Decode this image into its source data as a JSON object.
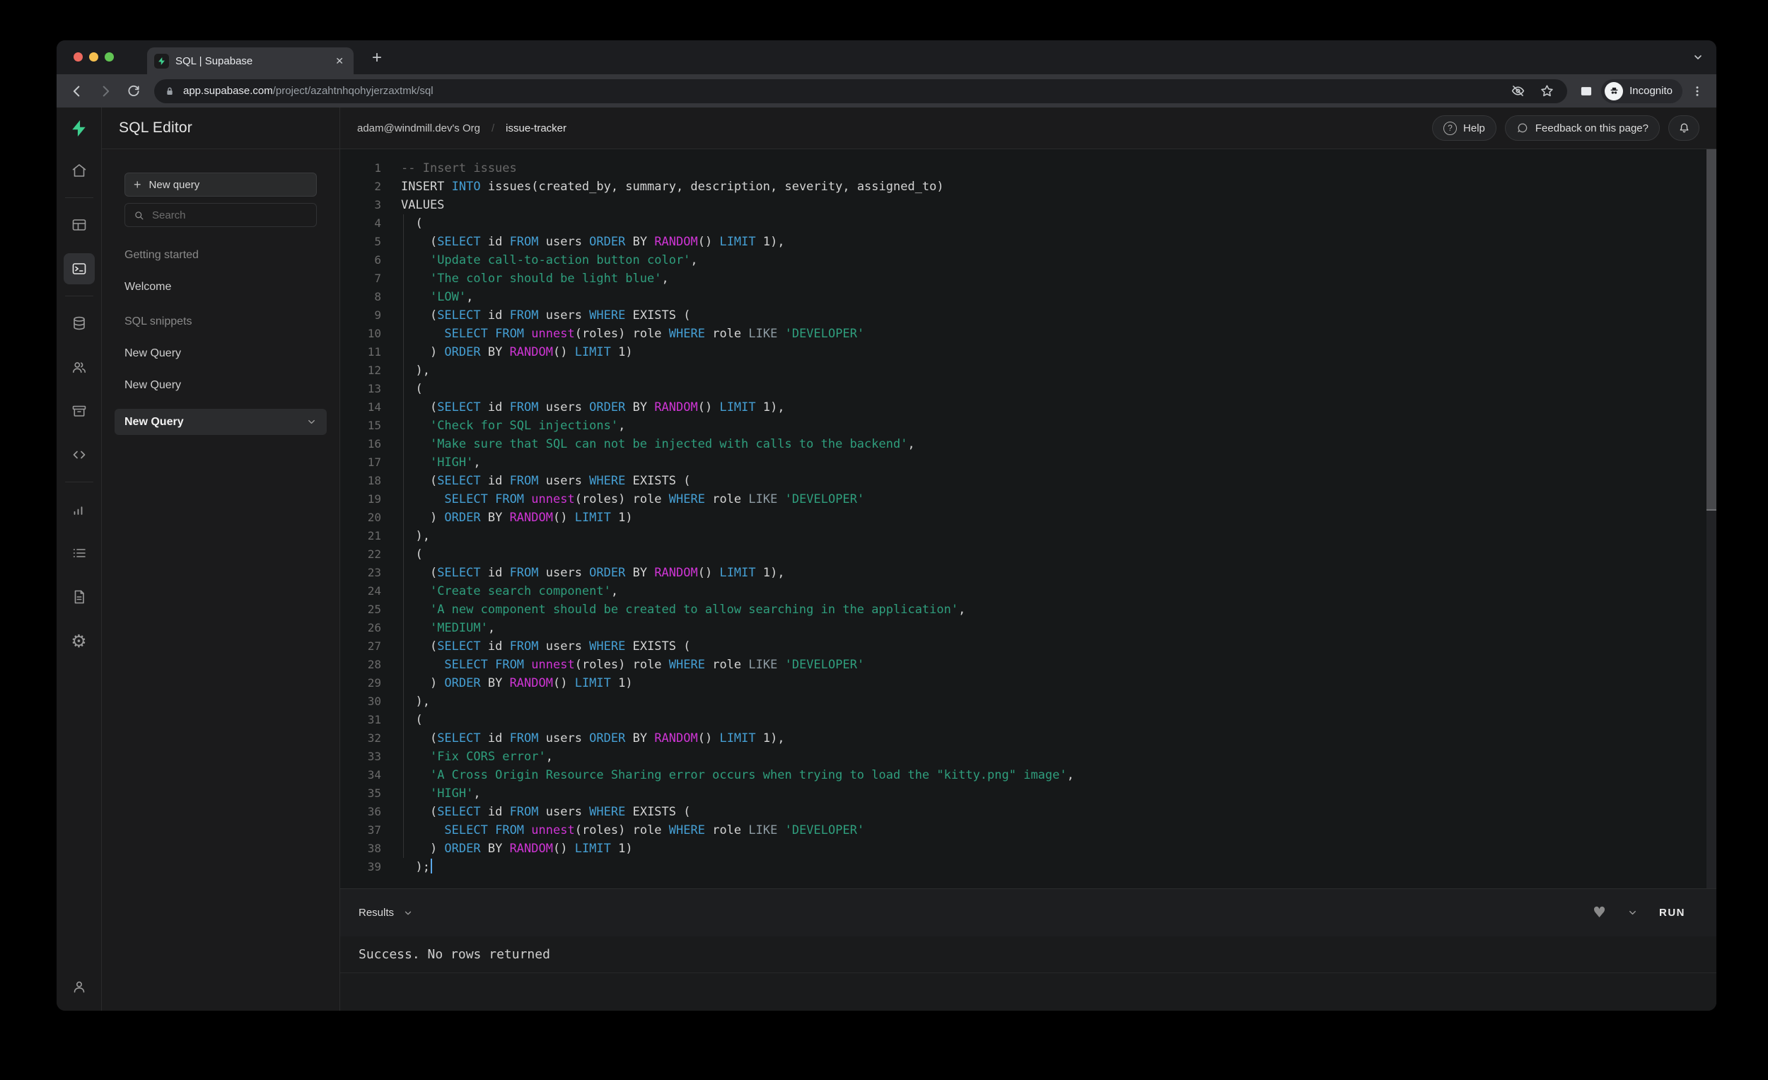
{
  "browser": {
    "tab_title": "SQL | Supabase",
    "url_domain": "app.supabase.com",
    "url_path": "/project/azahtnhqohyjerzaxtmk/sql",
    "incognito_label": "Incognito",
    "new_tab_glyph": "+",
    "close_tab_glyph": "✕",
    "traffic_lights": {
      "red": "#ed6a5f",
      "yellow": "#f5bf4f",
      "green": "#62c554"
    }
  },
  "header": {
    "org": "adam@windmill.dev's Org",
    "separator": "/",
    "project": "issue-tracker",
    "help_label": "Help",
    "help_glyph": "?",
    "feedback_label": "Feedback on this page?"
  },
  "rail": {
    "brand_color": "#3ecf8e",
    "items": [
      {
        "icon": "home"
      },
      {
        "icon": "table-editor"
      },
      {
        "icon": "sql-editor",
        "active": true
      },
      {
        "icon": "database"
      },
      {
        "icon": "auth-users"
      },
      {
        "icon": "storage"
      },
      {
        "icon": "code"
      },
      {
        "icon": "reports"
      },
      {
        "icon": "logs"
      },
      {
        "icon": "docs"
      },
      {
        "icon": "settings"
      },
      {
        "icon": "account",
        "position": "bottom"
      }
    ]
  },
  "panel": {
    "title": "SQL Editor",
    "new_query_button": "New query",
    "plus_glyph": "+",
    "search_placeholder": "Search",
    "sections": [
      {
        "label": "Getting started",
        "items": [
          {
            "label": "Welcome"
          }
        ]
      },
      {
        "label": "SQL snippets",
        "items": [
          {
            "label": "New Query"
          },
          {
            "label": "New Query"
          },
          {
            "label": "New Query",
            "active": true
          }
        ]
      }
    ]
  },
  "editor": {
    "colors": {
      "text": "#d4d4d4",
      "keyword": "#459fd4",
      "function": "#ce35d4",
      "string": "#2f9e7d",
      "comment": "#686868",
      "like": "#8e9ba3"
    },
    "lines": [
      {
        "tokens": [
          [
            "-- Insert issues",
            "com"
          ]
        ]
      },
      {
        "tokens": [
          [
            "INSERT ",
            "txt"
          ],
          [
            "INTO",
            "kw"
          ],
          [
            " issues(created_by, summary, description, severity, assigned_to)",
            "txt"
          ]
        ]
      },
      {
        "tokens": [
          [
            "VALUES",
            "txt"
          ]
        ]
      },
      {
        "tokens": [
          [
            "  (",
            "txt"
          ]
        ]
      },
      {
        "tokens": [
          [
            "    (",
            "txt"
          ],
          [
            "SELECT",
            "kw"
          ],
          [
            " id ",
            "txt"
          ],
          [
            "FROM",
            "kw"
          ],
          [
            " users ",
            "txt"
          ],
          [
            "ORDER",
            "kw"
          ],
          [
            " BY ",
            "txt"
          ],
          [
            "RANDOM",
            "fn"
          ],
          [
            "() ",
            "txt"
          ],
          [
            "LIMIT",
            "kw"
          ],
          [
            " 1),",
            "txt"
          ]
        ]
      },
      {
        "tokens": [
          [
            "    ",
            "txt"
          ],
          [
            "'Update call-to-action button color'",
            "str"
          ],
          [
            ",",
            "txt"
          ]
        ]
      },
      {
        "tokens": [
          [
            "    ",
            "txt"
          ],
          [
            "'The color should be light blue'",
            "str"
          ],
          [
            ",",
            "txt"
          ]
        ]
      },
      {
        "tokens": [
          [
            "    ",
            "txt"
          ],
          [
            "'LOW'",
            "str"
          ],
          [
            ",",
            "txt"
          ]
        ]
      },
      {
        "tokens": [
          [
            "    (",
            "txt"
          ],
          [
            "SELECT",
            "kw"
          ],
          [
            " id ",
            "txt"
          ],
          [
            "FROM",
            "kw"
          ],
          [
            " users ",
            "txt"
          ],
          [
            "WHERE",
            "kw"
          ],
          [
            " EXISTS (",
            "txt"
          ]
        ]
      },
      {
        "tokens": [
          [
            "      ",
            "txt"
          ],
          [
            "SELECT",
            "kw"
          ],
          [
            " ",
            "txt"
          ],
          [
            "FROM",
            "kw"
          ],
          [
            " ",
            "txt"
          ],
          [
            "unnest",
            "fn"
          ],
          [
            "(roles) role ",
            "txt"
          ],
          [
            "WHERE",
            "kw"
          ],
          [
            " role ",
            "txt"
          ],
          [
            "LIKE",
            "like"
          ],
          [
            " ",
            "txt"
          ],
          [
            "'DEVELOPER'",
            "str"
          ]
        ]
      },
      {
        "tokens": [
          [
            "    ) ",
            "txt"
          ],
          [
            "ORDER",
            "kw"
          ],
          [
            " BY ",
            "txt"
          ],
          [
            "RANDOM",
            "fn"
          ],
          [
            "() ",
            "txt"
          ],
          [
            "LIMIT",
            "kw"
          ],
          [
            " 1)",
            "txt"
          ]
        ]
      },
      {
        "tokens": [
          [
            "  ),",
            "txt"
          ]
        ]
      },
      {
        "tokens": [
          [
            "  (",
            "txt"
          ]
        ]
      },
      {
        "tokens": [
          [
            "    (",
            "txt"
          ],
          [
            "SELECT",
            "kw"
          ],
          [
            " id ",
            "txt"
          ],
          [
            "FROM",
            "kw"
          ],
          [
            " users ",
            "txt"
          ],
          [
            "ORDER",
            "kw"
          ],
          [
            " BY ",
            "txt"
          ],
          [
            "RANDOM",
            "fn"
          ],
          [
            "() ",
            "txt"
          ],
          [
            "LIMIT",
            "kw"
          ],
          [
            " 1),",
            "txt"
          ]
        ]
      },
      {
        "tokens": [
          [
            "    ",
            "txt"
          ],
          [
            "'Check for SQL injections'",
            "str"
          ],
          [
            ",",
            "txt"
          ]
        ]
      },
      {
        "tokens": [
          [
            "    ",
            "txt"
          ],
          [
            "'Make sure that SQL can not be injected with calls to the backend'",
            "str"
          ],
          [
            ",",
            "txt"
          ]
        ]
      },
      {
        "tokens": [
          [
            "    ",
            "txt"
          ],
          [
            "'HIGH'",
            "str"
          ],
          [
            ",",
            "txt"
          ]
        ]
      },
      {
        "tokens": [
          [
            "    (",
            "txt"
          ],
          [
            "SELECT",
            "kw"
          ],
          [
            " id ",
            "txt"
          ],
          [
            "FROM",
            "kw"
          ],
          [
            " users ",
            "txt"
          ],
          [
            "WHERE",
            "kw"
          ],
          [
            " EXISTS (",
            "txt"
          ]
        ]
      },
      {
        "tokens": [
          [
            "      ",
            "txt"
          ],
          [
            "SELECT",
            "kw"
          ],
          [
            " ",
            "txt"
          ],
          [
            "FROM",
            "kw"
          ],
          [
            " ",
            "txt"
          ],
          [
            "unnest",
            "fn"
          ],
          [
            "(roles) role ",
            "txt"
          ],
          [
            "WHERE",
            "kw"
          ],
          [
            " role ",
            "txt"
          ],
          [
            "LIKE",
            "like"
          ],
          [
            " ",
            "txt"
          ],
          [
            "'DEVELOPER'",
            "str"
          ]
        ]
      },
      {
        "tokens": [
          [
            "    ) ",
            "txt"
          ],
          [
            "ORDER",
            "kw"
          ],
          [
            " BY ",
            "txt"
          ],
          [
            "RANDOM",
            "fn"
          ],
          [
            "() ",
            "txt"
          ],
          [
            "LIMIT",
            "kw"
          ],
          [
            " 1)",
            "txt"
          ]
        ]
      },
      {
        "tokens": [
          [
            "  ),",
            "txt"
          ]
        ]
      },
      {
        "tokens": [
          [
            "  (",
            "txt"
          ]
        ]
      },
      {
        "tokens": [
          [
            "    (",
            "txt"
          ],
          [
            "SELECT",
            "kw"
          ],
          [
            " id ",
            "txt"
          ],
          [
            "FROM",
            "kw"
          ],
          [
            " users ",
            "txt"
          ],
          [
            "ORDER",
            "kw"
          ],
          [
            " BY ",
            "txt"
          ],
          [
            "RANDOM",
            "fn"
          ],
          [
            "() ",
            "txt"
          ],
          [
            "LIMIT",
            "kw"
          ],
          [
            " 1),",
            "txt"
          ]
        ]
      },
      {
        "tokens": [
          [
            "    ",
            "txt"
          ],
          [
            "'Create search component'",
            "str"
          ],
          [
            ",",
            "txt"
          ]
        ]
      },
      {
        "tokens": [
          [
            "    ",
            "txt"
          ],
          [
            "'A new component should be created to allow searching in the application'",
            "str"
          ],
          [
            ",",
            "txt"
          ]
        ]
      },
      {
        "tokens": [
          [
            "    ",
            "txt"
          ],
          [
            "'MEDIUM'",
            "str"
          ],
          [
            ",",
            "txt"
          ]
        ]
      },
      {
        "tokens": [
          [
            "    (",
            "txt"
          ],
          [
            "SELECT",
            "kw"
          ],
          [
            " id ",
            "txt"
          ],
          [
            "FROM",
            "kw"
          ],
          [
            " users ",
            "txt"
          ],
          [
            "WHERE",
            "kw"
          ],
          [
            " EXISTS (",
            "txt"
          ]
        ]
      },
      {
        "tokens": [
          [
            "      ",
            "txt"
          ],
          [
            "SELECT",
            "kw"
          ],
          [
            " ",
            "txt"
          ],
          [
            "FROM",
            "kw"
          ],
          [
            " ",
            "txt"
          ],
          [
            "unnest",
            "fn"
          ],
          [
            "(roles) role ",
            "txt"
          ],
          [
            "WHERE",
            "kw"
          ],
          [
            " role ",
            "txt"
          ],
          [
            "LIKE",
            "like"
          ],
          [
            " ",
            "txt"
          ],
          [
            "'DEVELOPER'",
            "str"
          ]
        ]
      },
      {
        "tokens": [
          [
            "    ) ",
            "txt"
          ],
          [
            "ORDER",
            "kw"
          ],
          [
            " BY ",
            "txt"
          ],
          [
            "RANDOM",
            "fn"
          ],
          [
            "() ",
            "txt"
          ],
          [
            "LIMIT",
            "kw"
          ],
          [
            " 1)",
            "txt"
          ]
        ]
      },
      {
        "tokens": [
          [
            "  ),",
            "txt"
          ]
        ]
      },
      {
        "tokens": [
          [
            "  (",
            "txt"
          ]
        ]
      },
      {
        "tokens": [
          [
            "    (",
            "txt"
          ],
          [
            "SELECT",
            "kw"
          ],
          [
            " id ",
            "txt"
          ],
          [
            "FROM",
            "kw"
          ],
          [
            " users ",
            "txt"
          ],
          [
            "ORDER",
            "kw"
          ],
          [
            " BY ",
            "txt"
          ],
          [
            "RANDOM",
            "fn"
          ],
          [
            "() ",
            "txt"
          ],
          [
            "LIMIT",
            "kw"
          ],
          [
            " 1),",
            "txt"
          ]
        ]
      },
      {
        "tokens": [
          [
            "    ",
            "txt"
          ],
          [
            "'Fix CORS error'",
            "str"
          ],
          [
            ",",
            "txt"
          ]
        ]
      },
      {
        "tokens": [
          [
            "    ",
            "txt"
          ],
          [
            "'A Cross Origin Resource Sharing error occurs when trying to load the \"kitty.png\" image'",
            "str"
          ],
          [
            ",",
            "txt"
          ]
        ]
      },
      {
        "tokens": [
          [
            "    ",
            "txt"
          ],
          [
            "'HIGH'",
            "str"
          ],
          [
            ",",
            "txt"
          ]
        ]
      },
      {
        "tokens": [
          [
            "    (",
            "txt"
          ],
          [
            "SELECT",
            "kw"
          ],
          [
            " id ",
            "txt"
          ],
          [
            "FROM",
            "kw"
          ],
          [
            " users ",
            "txt"
          ],
          [
            "WHERE",
            "kw"
          ],
          [
            " EXISTS (",
            "txt"
          ]
        ]
      },
      {
        "tokens": [
          [
            "      ",
            "txt"
          ],
          [
            "SELECT",
            "kw"
          ],
          [
            " ",
            "txt"
          ],
          [
            "FROM",
            "kw"
          ],
          [
            " ",
            "txt"
          ],
          [
            "unnest",
            "fn"
          ],
          [
            "(roles) role ",
            "txt"
          ],
          [
            "WHERE",
            "kw"
          ],
          [
            " role ",
            "txt"
          ],
          [
            "LIKE",
            "like"
          ],
          [
            " ",
            "txt"
          ],
          [
            "'DEVELOPER'",
            "str"
          ]
        ]
      },
      {
        "tokens": [
          [
            "    ) ",
            "txt"
          ],
          [
            "ORDER",
            "kw"
          ],
          [
            " BY ",
            "txt"
          ],
          [
            "RANDOM",
            "fn"
          ],
          [
            "() ",
            "txt"
          ],
          [
            "LIMIT",
            "kw"
          ],
          [
            " 1)",
            "txt"
          ]
        ]
      },
      {
        "tokens": [
          [
            "  );",
            "txt"
          ]
        ],
        "cursor": true
      }
    ]
  },
  "results": {
    "label": "Results",
    "run_label": "RUN",
    "heart_glyph": "♥",
    "message": "Success. No rows returned"
  },
  "icons_glyphs": {
    "gear": "⚙"
  }
}
